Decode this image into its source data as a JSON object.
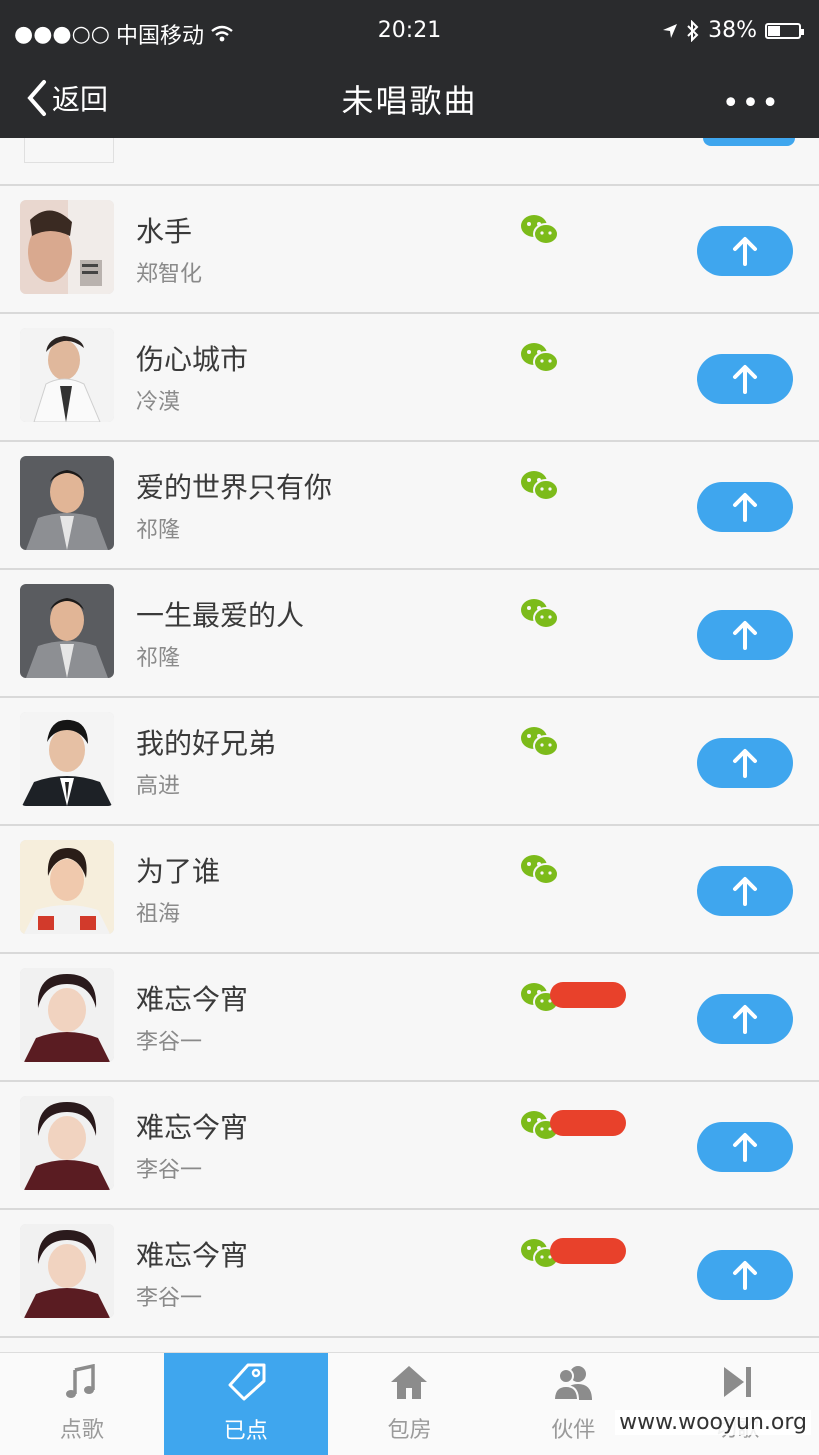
{
  "status_bar": {
    "signal": "●●●○○",
    "carrier": "中国移动",
    "time": "20:21",
    "battery": "38%"
  },
  "nav": {
    "back_label": "返回",
    "title": "未唱歌曲",
    "more": "•••"
  },
  "songs": [
    {
      "title": "水手",
      "artist": "郑智化",
      "redacted": false
    },
    {
      "title": "伤心城市",
      "artist": "冷漠",
      "redacted": false
    },
    {
      "title": "爱的世界只有你",
      "artist": "祁隆",
      "redacted": false
    },
    {
      "title": "一生最爱的人",
      "artist": "祁隆",
      "redacted": false
    },
    {
      "title": "我的好兄弟",
      "artist": "高进",
      "redacted": false
    },
    {
      "title": "为了谁",
      "artist": "祖海",
      "redacted": false
    },
    {
      "title": "难忘今宵",
      "artist": "李谷一",
      "redacted": true
    },
    {
      "title": "难忘今宵",
      "artist": "李谷一",
      "redacted": true
    },
    {
      "title": "难忘今宵",
      "artist": "李谷一",
      "redacted": true
    }
  ],
  "tabs": [
    {
      "label": "点歌",
      "icon": "music-note-icon",
      "active": false
    },
    {
      "label": "已点",
      "icon": "tag-icon",
      "active": true
    },
    {
      "label": "包房",
      "icon": "home-icon",
      "active": false
    },
    {
      "label": "伙伴",
      "icon": "users-icon",
      "active": false
    },
    {
      "label": "切歌",
      "icon": "skip-next-icon",
      "active": false
    }
  ],
  "watermark": "www.wooyun.org",
  "colors": {
    "accent": "#3fa6ee",
    "header_bg": "#2a2b2d",
    "wechat": "#7cbb1a",
    "redaction": "#e8412b"
  }
}
